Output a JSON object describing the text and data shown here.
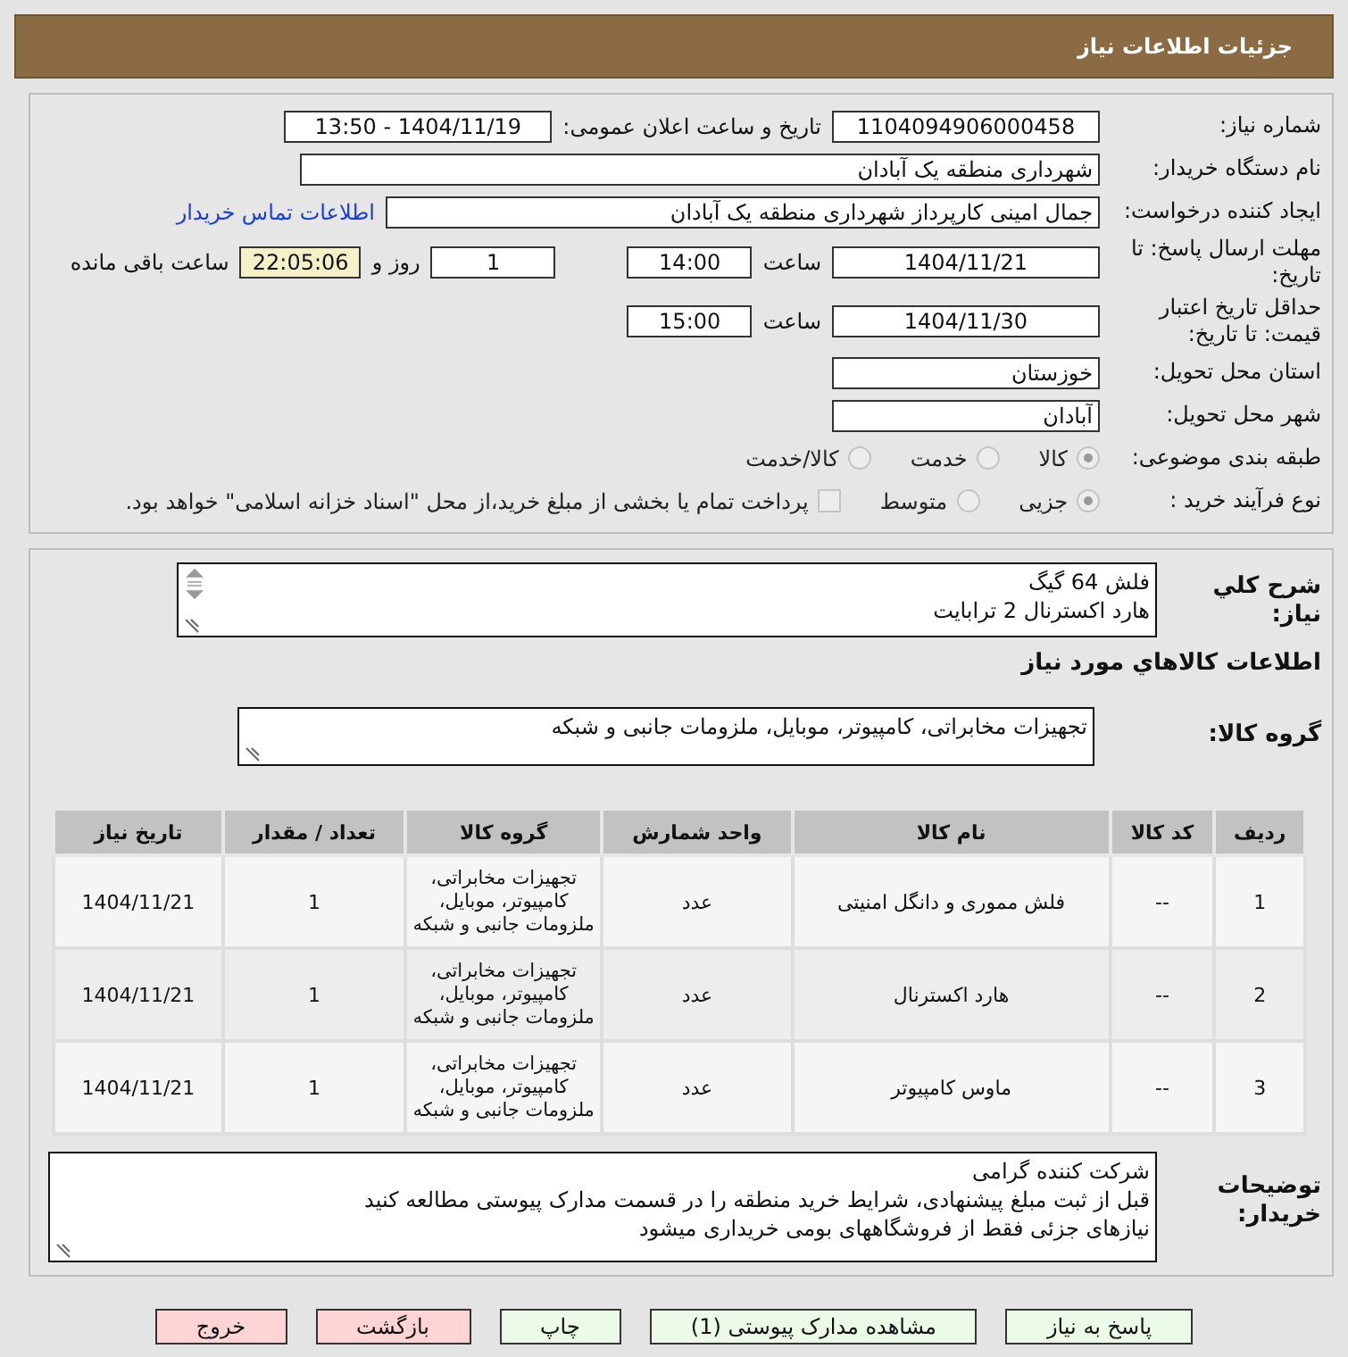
{
  "header": {
    "title": "جزئیات اطلاعات نیاز"
  },
  "details": {
    "rows": [
      {
        "items": [
          {
            "kind": "label",
            "text": "شماره نیاز:"
          },
          {
            "kind": "field",
            "value": "1104094906000458"
          },
          {
            "kind": "far-label",
            "text": "تاریخ و ساعت اعلان عمومی:"
          },
          {
            "kind": "field",
            "value": "1404/11/19 - 13:50"
          }
        ]
      },
      {
        "items": [
          {
            "kind": "label",
            "text": "نام دستگاه خریدار:"
          },
          {
            "kind": "wide-field",
            "value": "شهرداری منطقه یک آبادان"
          }
        ]
      },
      {
        "items": [
          {
            "kind": "label",
            "text": "ایجاد کننده درخواست:"
          },
          {
            "kind": "long-field",
            "value": "جمال امینی کارپرداز شهرداری منطقه یک آبادان"
          },
          {
            "kind": "link",
            "text": "اطلاعات تماس خریدار"
          }
        ]
      },
      {
        "items": [
          {
            "kind": "label",
            "text": "مهلت ارسال پاسخ: تا تاریخ:"
          },
          {
            "kind": "field",
            "value": "1404/11/21"
          },
          {
            "kind": "text",
            "text": "ساعت"
          },
          {
            "kind": "short-field",
            "value": "14:00"
          },
          {
            "kind": "far-short-field",
            "value": "1"
          },
          {
            "kind": "text",
            "text": "روز و"
          },
          {
            "kind": "timer",
            "value": "22:05:06"
          },
          {
            "kind": "text",
            "text": "ساعت باقی مانده"
          }
        ]
      },
      {
        "items": [
          {
            "kind": "label",
            "text": "حداقل تاریخ اعتبار قیمت: تا تاریخ:"
          },
          {
            "kind": "field",
            "value": "1404/11/30"
          },
          {
            "kind": "text",
            "text": "ساعت"
          },
          {
            "kind": "short-field",
            "value": "15:00"
          }
        ]
      },
      {
        "items": [
          {
            "kind": "label",
            "text": "استان محل تحویل:"
          },
          {
            "kind": "text-field",
            "value": "خوزستان"
          }
        ]
      },
      {
        "items": [
          {
            "kind": "label",
            "text": "شهر محل تحویل:"
          },
          {
            "kind": "text-field",
            "value": "آبادان"
          }
        ]
      },
      {
        "items": [
          {
            "kind": "label",
            "text": "طبقه بندی موضوعی:"
          },
          {
            "kind": "radio",
            "text": "کالا",
            "selected": true
          },
          {
            "kind": "radio",
            "text": "خدمت",
            "selected": false
          },
          {
            "kind": "radio",
            "text": "کالا/خدمت",
            "selected": false
          }
        ]
      },
      {
        "items": [
          {
            "kind": "label",
            "text": "نوع فرآیند خرید :"
          },
          {
            "kind": "radio",
            "text": "جزیی",
            "selected": true
          },
          {
            "kind": "radio",
            "text": "متوسط",
            "selected": false
          },
          {
            "kind": "checkbox",
            "text": "پرداخت تمام یا بخشی از مبلغ خرید،از محل \"اسناد خزانه اسلامی\" خواهد بود.",
            "checked": false
          }
        ]
      }
    ]
  },
  "description": {
    "label": "شرح کلي نياز:",
    "lines": [
      "فلش 64 گیگ",
      "هارد اکسترنال 2 ترابایت"
    ]
  },
  "goods_heading": "اطلاعات کالاهاي مورد نياز",
  "goods_group": {
    "label": "گروه کالا:",
    "value": "تجهیزات مخابراتی، کامپیوتر، موبایل، ملزومات جانبی و شبکه"
  },
  "table": {
    "columns": [
      "ردیف",
      "کد کالا",
      "نام کالا",
      "واحد شمارش",
      "گروه کالا",
      "تعداد / مقدار",
      "تاریخ نیاز"
    ],
    "rows": [
      [
        "1",
        "--",
        "فلش مموری و دانگل امنیتی",
        "عدد",
        "تجهیزات مخابراتی، کامپیوتر، موبایل، ملزومات جانبی و شبکه",
        "1",
        "1404/11/21"
      ],
      [
        "2",
        "--",
        "هارد اکسترنال",
        "عدد",
        "تجهیزات مخابراتی، کامپیوتر، موبایل، ملزومات جانبی و شبکه",
        "1",
        "1404/11/21"
      ],
      [
        "3",
        "--",
        "ماوس کامپیوتر",
        "عدد",
        "تجهیزات مخابراتی، کامپیوتر، موبایل، ملزومات جانبی و شبکه",
        "1",
        "1404/11/21"
      ]
    ]
  },
  "buyer_notes": {
    "label": "توضیحات خریدار:",
    "lines": [
      "شرکت کننده گرامی",
      "قبل از ثبت مبلغ پیشنهادی، شرایط خرید منطقه را در قسمت مدارک پیوستی مطالعه کنید",
      "نیازهای جزئی فقط از فروشگاههای بومی خریداری میشود"
    ]
  },
  "buttons": [
    {
      "kind": "primary",
      "label": "پاسخ به نیاز"
    },
    {
      "kind": "primary",
      "label": "مشاهده مدارک پیوستی (1)"
    },
    {
      "kind": "primary",
      "label": "چاپ"
    },
    {
      "kind": "danger",
      "label": "بازگشت"
    },
    {
      "kind": "danger",
      "label": "خروج"
    }
  ]
}
